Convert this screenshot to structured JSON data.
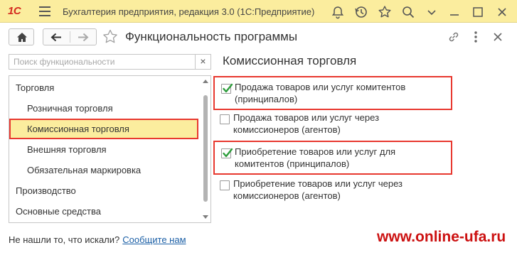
{
  "titlebar": {
    "logo_text": "1С",
    "title": "Бухгалтерия предприятия, редакция 3.0  (1С:Предприятие)",
    "icons": [
      "bell-icon",
      "history-icon",
      "star-icon",
      "search-icon",
      "dropdown-menu-icon",
      "minimize-icon",
      "maximize-icon",
      "close-icon"
    ]
  },
  "toolbar": {
    "home_icon": "home-icon",
    "back_icon": "arrow-left-icon",
    "forward_icon": "arrow-right-icon",
    "favorite_icon": "star-outline-icon",
    "page_title": "Функциональность программы",
    "link_icon": "link-icon",
    "more_icon": "more-icon",
    "close_icon": "close-icon"
  },
  "search": {
    "placeholder": "Поиск функциональности",
    "value": "",
    "clear_label": "×"
  },
  "tree": {
    "items": [
      {
        "label": "Торговля",
        "level": 0,
        "selected": false
      },
      {
        "label": "Розничная торговля",
        "level": 1,
        "selected": false
      },
      {
        "label": "Комиссионная торговля",
        "level": 1,
        "selected": true
      },
      {
        "label": "Внешняя торговля",
        "level": 1,
        "selected": false
      },
      {
        "label": "Обязательная маркировка",
        "level": 1,
        "selected": false
      },
      {
        "label": "Производство",
        "level": 0,
        "selected": false
      },
      {
        "label": "Основные средства",
        "level": 0,
        "selected": false
      }
    ]
  },
  "footer": {
    "not_found_text": "Не нашли то, что искали?",
    "contact_link": "Сообщите нам"
  },
  "section": {
    "title": "Комиссионная торговля",
    "options": [
      {
        "label": "Продажа товаров или услуг комитентов\n(принципалов)",
        "checked": true,
        "highlighted": true
      },
      {
        "label": "Продажа товаров или услуг через\nкомиссионеров (агентов)",
        "checked": false,
        "highlighted": false
      },
      {
        "label": "Приобретение товаров или услуг для\nкомитентов (принципалов)",
        "checked": true,
        "highlighted": true
      },
      {
        "label": "Приобретение товаров или услуг через\nкомиссионеров (агентов)",
        "checked": false,
        "highlighted": false
      }
    ]
  },
  "watermark": "www.online-ufa.ru",
  "colors": {
    "titlebar_bg": "#fbed9e",
    "selection_bg": "#fbed9e",
    "highlight_border": "#e8382f",
    "check_color": "#2e9d3c",
    "link_color": "#1b5fa6",
    "watermark_color": "#cc1111"
  }
}
